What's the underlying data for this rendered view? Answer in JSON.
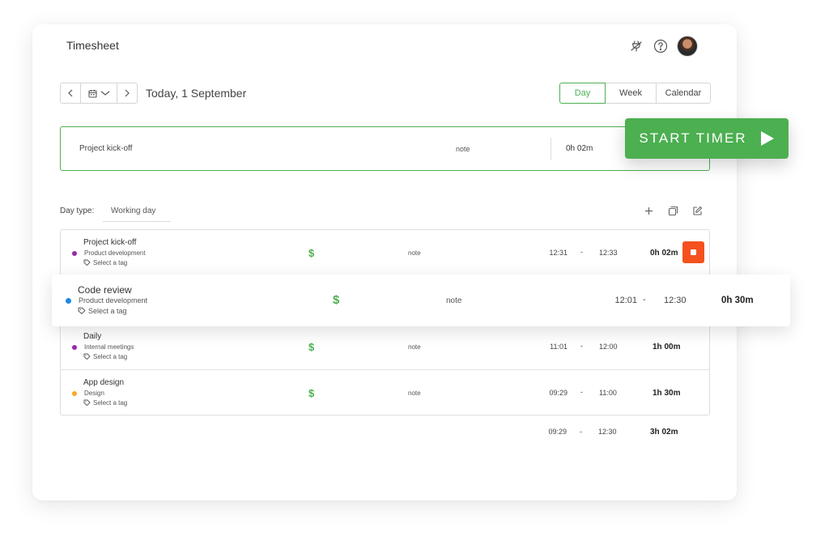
{
  "header": {
    "title": "Timesheet",
    "icons": [
      "plug-icon",
      "help-icon",
      "avatar"
    ]
  },
  "date_nav": {
    "label": "Today, 1 September"
  },
  "view_switch": {
    "day": "Day",
    "week": "Week",
    "calendar": "Calendar",
    "selected": "Day"
  },
  "timer": {
    "description": "Project kick-off",
    "note": "note",
    "duration": "0h 02m",
    "start_label": "START TIMER"
  },
  "day_type": {
    "label": "Day type:",
    "value": "Working day"
  },
  "entries": [
    {
      "name": "Project kick-off",
      "project": "Product development",
      "project_color": "#9c27b0",
      "tag": "Select a tag",
      "billable": "$",
      "note": "note",
      "start": "12:31",
      "dash": "-",
      "end": "12:33",
      "duration": "0h 02m",
      "running": true
    },
    {
      "name": "Code review",
      "project": "Product development",
      "project_color": "#1e88e5",
      "tag": "Select a tag",
      "billable": "$",
      "note": "note",
      "start": "12:01",
      "dash": "-",
      "end": "12:30",
      "duration": "0h 30m",
      "running": false
    },
    {
      "name": "Daily",
      "project": "Internal meetings",
      "project_color": "#9c27b0",
      "tag": "Select a tag",
      "billable": "$",
      "note": "note",
      "start": "11:01",
      "dash": "-",
      "end": "12:00",
      "duration": "1h 00m",
      "running": false
    },
    {
      "name": "App design",
      "project": "Design",
      "project_color": "#f9a825",
      "tag": "Select a tag",
      "billable": "$",
      "note": "note",
      "start": "09:29",
      "dash": "-",
      "end": "11:00",
      "duration": "1h 30m",
      "running": false
    }
  ],
  "totals": {
    "start": "09:29",
    "dash": "-",
    "end": "12:30",
    "duration": "3h 02m"
  },
  "colors": {
    "accent": "#4caf50",
    "stop": "#f4511e"
  }
}
